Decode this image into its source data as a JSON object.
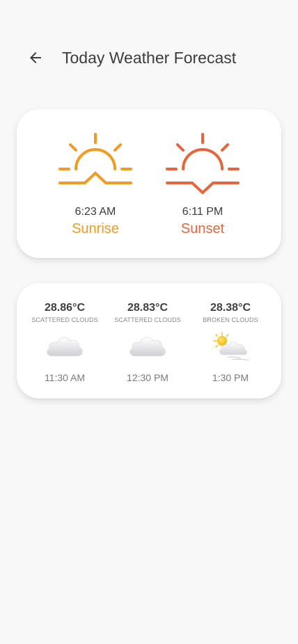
{
  "header": {
    "title": "Today Weather Forecast"
  },
  "sun": {
    "sunrise": {
      "time": "6:23 AM",
      "label": "Sunrise",
      "color": "#f39a22"
    },
    "sunset": {
      "time": "6:11 PM",
      "label": "Sunset",
      "color": "#e8643a"
    }
  },
  "forecast": [
    {
      "temp": "28.86°C",
      "description": "SCATTERED CLOUDS",
      "time": "11:30 AM",
      "icon": "cloud-icon"
    },
    {
      "temp": "28.83°C",
      "description": "SCATTERED CLOUDS",
      "time": "12:30 PM",
      "icon": "cloud-icon"
    },
    {
      "temp": "28.38°C",
      "description": "BROKEN CLOUDS",
      "time": "1:30 PM",
      "icon": "sun-behind-cloud-icon"
    }
  ]
}
